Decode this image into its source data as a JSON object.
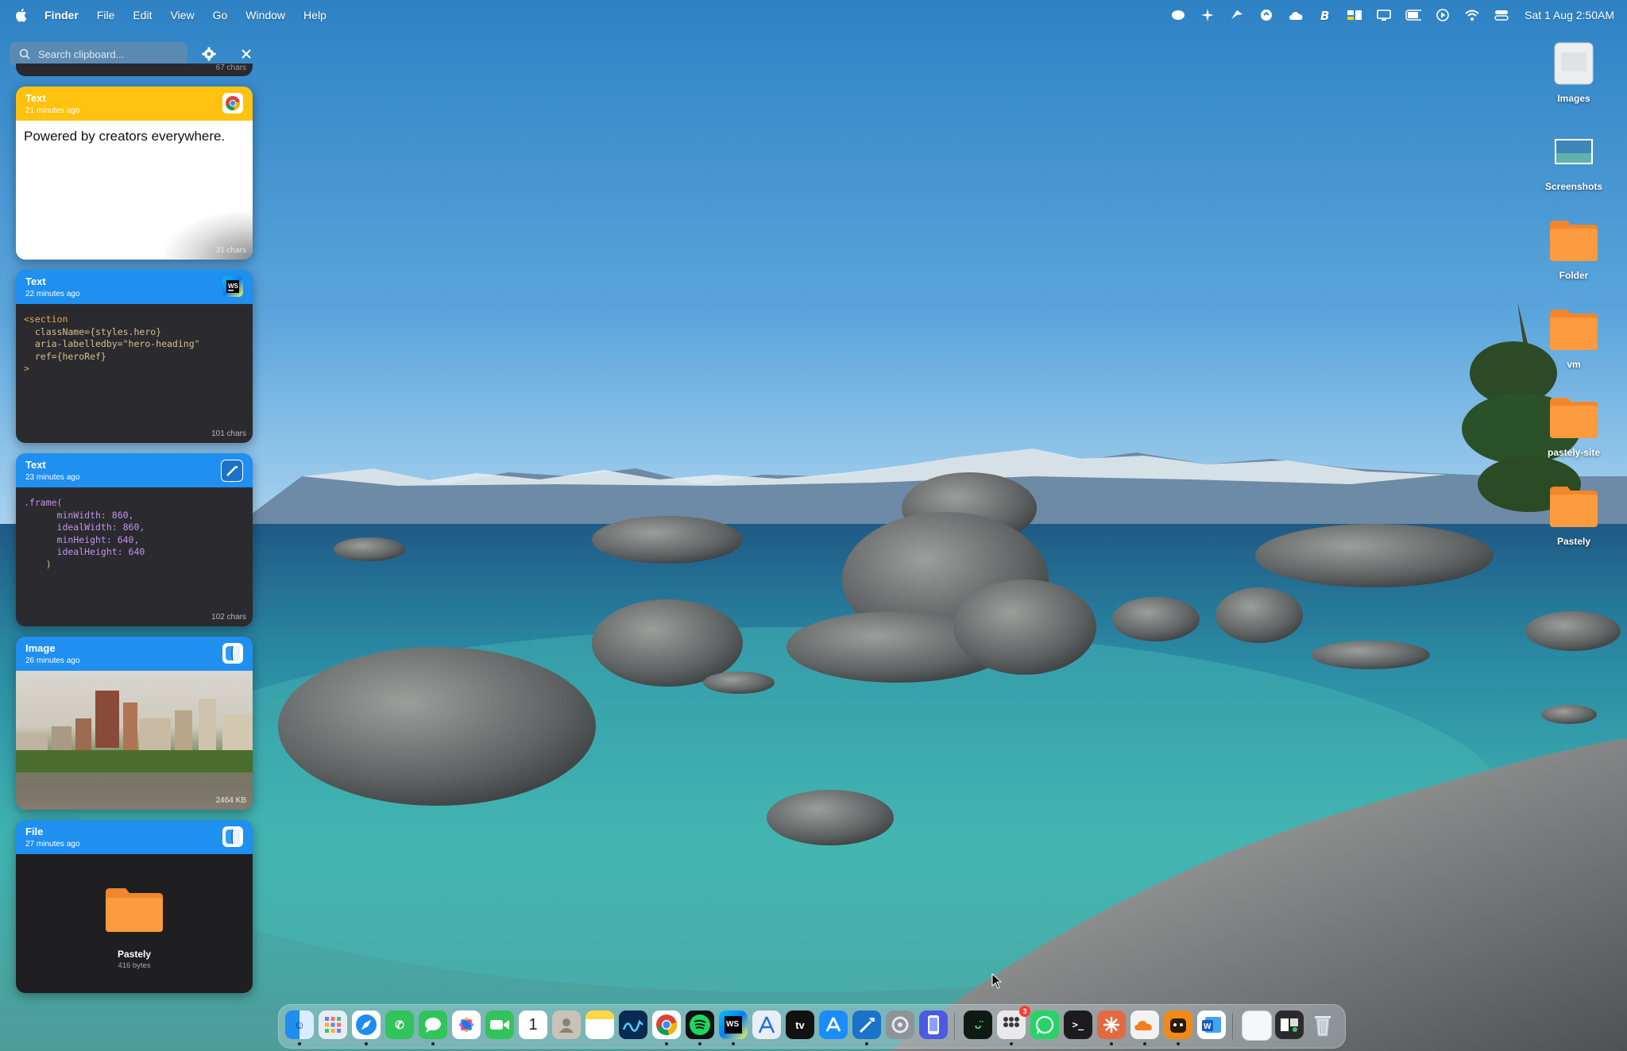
{
  "menubar": {
    "apple_icon": "apple-logo-icon",
    "menus": [
      "Finder",
      "File",
      "Edit",
      "View",
      "Go",
      "Window",
      "Help"
    ],
    "status_icons": [
      "app-status-icon",
      "sparkle-icon",
      "wing-icon",
      "refresh-icon",
      "cloud-icon",
      "bold-b-icon",
      "window-manager-icon",
      "display-icon",
      "battery-icon",
      "play-circle-icon",
      "wifi-icon",
      "control-center-icon"
    ],
    "clock": "Sat 1 Aug  2:50AM"
  },
  "clipboard": {
    "search_placeholder": "Search clipboard...",
    "prev_card_size": "67 chars",
    "cards": [
      {
        "type": "Text",
        "time": "21 minutes ago",
        "app": "chrome",
        "content": "Powered by creators everywhere.",
        "size": "31 chars",
        "header_color": "#ffc20e"
      },
      {
        "type": "Text",
        "time": "22 minutes ago",
        "app": "webstorm",
        "size": "101 chars",
        "header_color": "#1f8ff0",
        "code_lines": [
          "<section",
          "  className={styles.hero}",
          "  aria-labelledby=\"hero-heading\"",
          "  ref={heroRef}",
          ">"
        ]
      },
      {
        "type": "Text",
        "time": "23 minutes ago",
        "app": "xcode",
        "size": "102 chars",
        "header_color": "#1f8ff0",
        "code_lines": [
          ".frame(",
          "      minWidth: 860,",
          "      idealWidth: 860,",
          "      minHeight: 640,",
          "      idealHeight: 640",
          "    )"
        ]
      },
      {
        "type": "Image",
        "time": "26 minutes ago",
        "app": "finder",
        "size": "2464 KB",
        "header_color": "#1f8ff0"
      },
      {
        "type": "File",
        "time": "27 minutes ago",
        "app": "finder",
        "file_name": "Pastely",
        "size": "416 bytes",
        "header_color": "#1f8ff0"
      }
    ]
  },
  "desktop_icons": [
    "Images",
    "Screenshots",
    "Folder",
    "vm",
    "pastely-site",
    "Pastely"
  ],
  "dock": {
    "apps": [
      "Finder",
      "Launchpad",
      "Safari",
      "Phone",
      "Messages",
      "Photos",
      "FaceTime",
      "Calendar",
      "Contacts",
      "Notes",
      "Freeform",
      "Chrome",
      "Spotify",
      "WebStorm",
      "Instruments",
      "Apple TV",
      "App Store",
      "Xcode",
      "System Settings",
      "Simulator",
      "Terminal-app",
      "Tailscale",
      "WhatsApp",
      "Terminal",
      "Claude",
      "Cloudflare",
      "Pastely",
      "Word",
      "Preview",
      "Screen Recorder",
      "Trash"
    ],
    "calendar_day": "1",
    "badge_count": "3"
  }
}
